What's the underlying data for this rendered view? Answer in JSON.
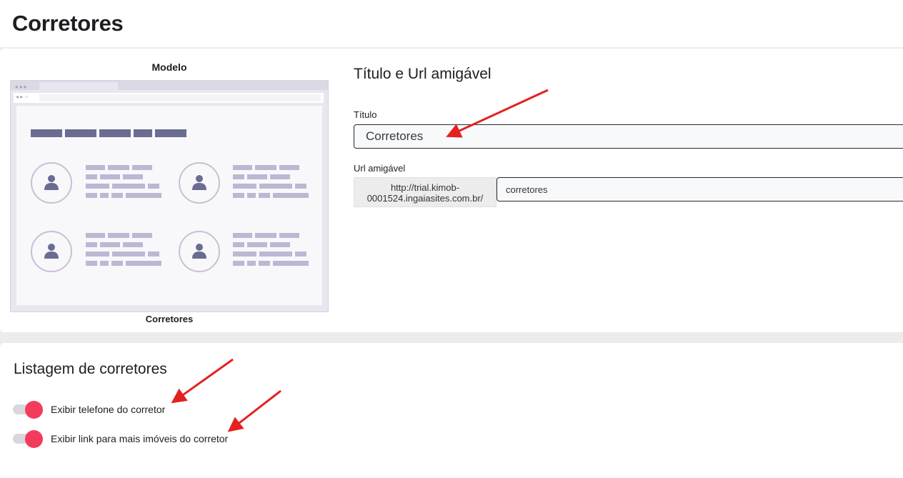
{
  "page": {
    "title": "Corretores"
  },
  "preview": {
    "label": "Modelo",
    "caption": "Corretores"
  },
  "title_section": {
    "heading": "Título e Url amigável",
    "title_label": "Título",
    "title_value": "Corretores",
    "url_label": "Url amigável",
    "url_prefix": "http://trial.kimob-0001524.ingaiasites.com.br/",
    "url_value": "corretores"
  },
  "listing_section": {
    "heading": "Listagem de corretores",
    "toggles": [
      {
        "label": "Exibir telefone do corretor",
        "on": true
      },
      {
        "label": "Exibir link para mais imóveis do corretor",
        "on": true
      }
    ]
  },
  "colors": {
    "accent": "#f53b5d",
    "annotation_arrow": "#e3211f"
  },
  "icons": [
    "user-icon",
    "arrow-annotation"
  ]
}
